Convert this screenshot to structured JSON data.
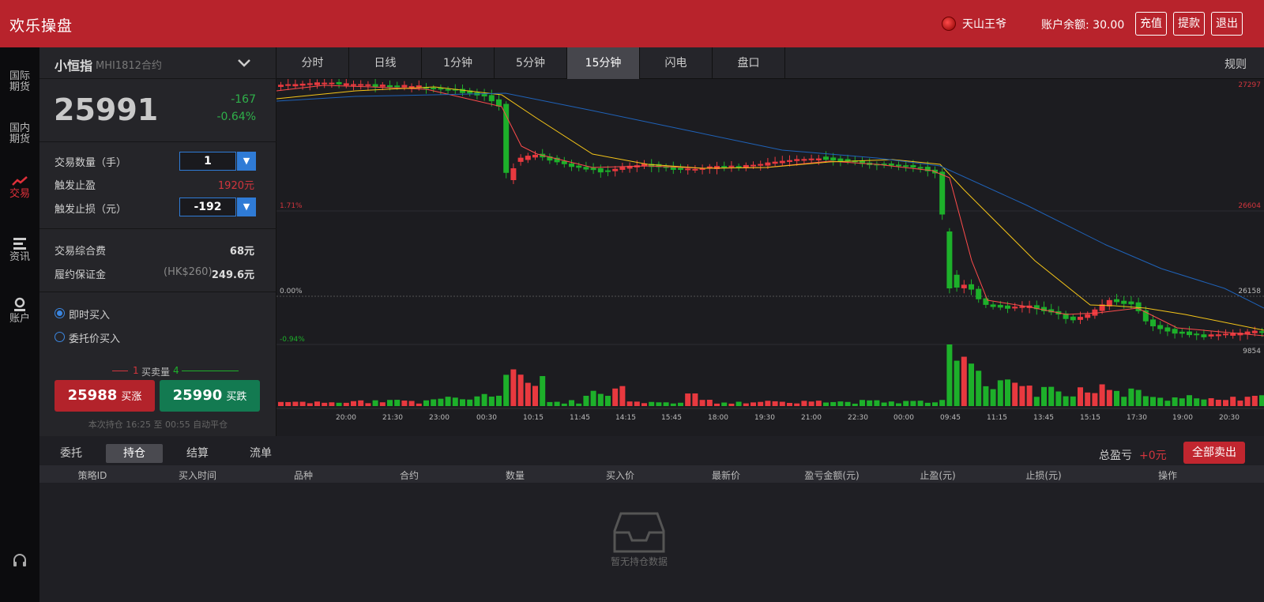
{
  "header": {
    "brand": "欢乐操盘",
    "username": "天山王爷",
    "balance": "账户余额: 30.00",
    "buttons": [
      "充值",
      "提款",
      "退出"
    ]
  },
  "nav": [
    {
      "label": "国际\n期货",
      "icon": ""
    },
    {
      "label": "国内\n期货",
      "icon": ""
    },
    {
      "label": "交易",
      "icon": "trend-icon"
    },
    {
      "label": "资讯",
      "icon": "list-icon"
    },
    {
      "label": "账户",
      "icon": "user-icon"
    }
  ],
  "panel": {
    "name": "小恒指",
    "contract": "MHI1812合约",
    "price": "25991",
    "change": "-167",
    "change_pct": "-0.64%",
    "qty_label": "交易数量（手）",
    "qty_value": "1",
    "tp_label": "触发止盈",
    "tp_value": "1920元",
    "sl_label": "触发止损（元）",
    "sl_value": "-192",
    "fee_label": "交易综合费",
    "fee_value": "68元",
    "margin_label": "履约保证金",
    "margin_hk": "(HK$260)",
    "margin_value": "249.6元",
    "radio1": "即时买入",
    "radio2": "委托价买入",
    "ratio_left": "1",
    "ratio_mid": "买卖量",
    "ratio_right": "4",
    "buy_price": "25988",
    "buy_label": "买涨",
    "sell_price": "25990",
    "sell_label": "买跌",
    "hold_note": "本次持仓 16:25 至 00:55 自动平仓"
  },
  "tabs": [
    "分时",
    "日线",
    "1分钟",
    "5分钟",
    "15分钟",
    "闪电",
    "盘口"
  ],
  "active_tab": "15分钟",
  "rules": "规则",
  "chart_data": {
    "type": "candlestick",
    "y_labels_right": [
      "27297",
      "26604",
      "26158",
      "9854"
    ],
    "pct_labels_left": [
      "1.71%",
      "0.00%",
      "-0.94%"
    ],
    "x_ticks": [
      "20:00",
      "21:30",
      "23:00",
      "00:30",
      "10:15",
      "11:45",
      "14:15",
      "15:45",
      "18:00",
      "19:30",
      "21:00",
      "22:30",
      "00:00",
      "09:45",
      "11:15",
      "13:45",
      "15:15",
      "17:30",
      "19:00",
      "20:30"
    ],
    "colors": {
      "up": "#e8393f",
      "down": "#1db02a",
      "ma1": "#ff4c4c",
      "ma2": "#f5c518",
      "ma3": "#1f62b8"
    }
  },
  "bottom": {
    "tabs": [
      "委托",
      "持仓",
      "结算",
      "流单"
    ],
    "active_tab": "持仓",
    "pnl_label": "总盈亏",
    "pnl_value": "+0元",
    "sell_all": "全部卖出",
    "columns": [
      "策略ID",
      "买入时间",
      "品种",
      "合约",
      "数量",
      "买入价",
      "最新价",
      "盈亏金额(元)",
      "止盈(元)",
      "止损(元)",
      "操作"
    ],
    "empty": "暂无持仓数据"
  }
}
